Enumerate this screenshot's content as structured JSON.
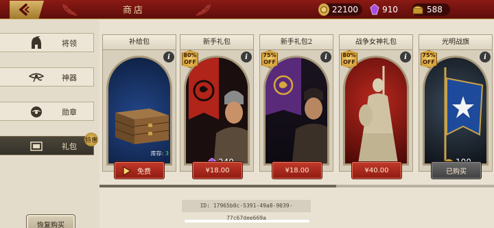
{
  "header": {
    "title": "商店",
    "resources": [
      {
        "icon": "gold-coin-icon",
        "value": "22100"
      },
      {
        "icon": "purple-gem-icon",
        "value": "910"
      },
      {
        "icon": "treasure-chest-icon",
        "value": "588"
      }
    ]
  },
  "sidebar": {
    "tabs": [
      {
        "label": "将领",
        "icon": "helmet-icon"
      },
      {
        "label": "神器",
        "icon": "eye-of-horus-icon"
      },
      {
        "label": "勋章",
        "icon": "medal-wings-icon"
      },
      {
        "label": "礼包",
        "icon": "gift-scroll-icon",
        "badge": "特惠"
      }
    ],
    "restore_label": "恢复购买"
  },
  "cards": [
    {
      "title": "补给包",
      "stock_label": "库存:",
      "stock_value": "3",
      "button": "免费"
    },
    {
      "title": "新手礼包",
      "discount": "80%",
      "off": "OFF",
      "cost": "240",
      "button": "¥18.00"
    },
    {
      "title": "新手礼包2",
      "discount": "75%",
      "off": "OFF",
      "button": "¥18.00"
    },
    {
      "title": "战争女神礼包",
      "discount": "80%",
      "off": "OFF",
      "button": "¥40.00"
    },
    {
      "title": "光明战旗",
      "discount": "75%",
      "off": "OFF",
      "cost": "100",
      "button": "已购买"
    }
  ],
  "info_glyph": "i",
  "footer": {
    "id_text": "ID: 17965b0c-5391-49a8-9039-77c67dee669a"
  },
  "colors": {
    "header_red": "#7a1410",
    "gold": "#c9a24a",
    "button_red": "#b02a1c"
  }
}
